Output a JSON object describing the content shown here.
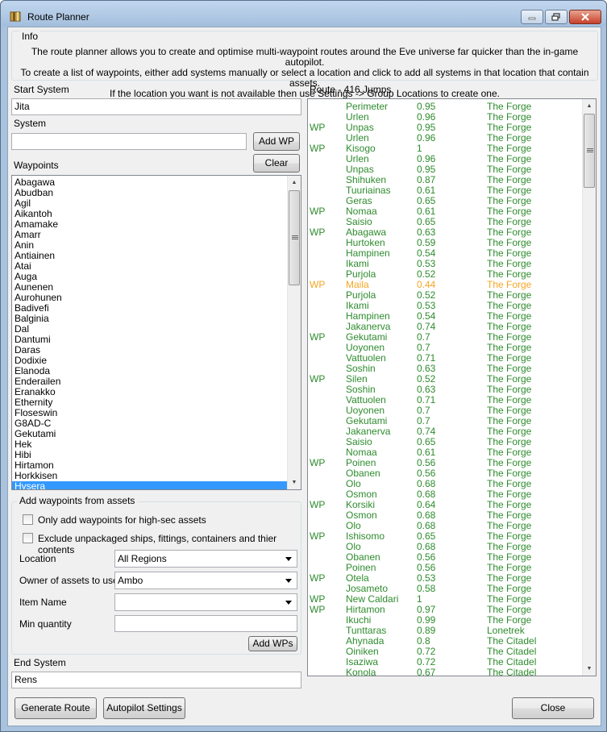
{
  "window": {
    "title": "Route Planner"
  },
  "info": {
    "legend": "Info",
    "line1": "The route planner allows you to create and optimise multi-waypoint routes around the Eve universe far quicker than the in-game autopilot.",
    "line2": "To create a list of waypoints, either add systems manually or select a location and click to add all systems in that location that contain assets.",
    "line3": "If the location you want is not available then use Settings -> Group Locations to create one."
  },
  "start_system": {
    "label": "Start System",
    "value": "Jita"
  },
  "system": {
    "label": "System",
    "value": ""
  },
  "buttons": {
    "add_wp": "Add WP",
    "clear": "Clear",
    "add_wps": "Add WPs",
    "generate_route": "Generate Route",
    "autopilot_settings": "Autopilot Settings",
    "close": "Close"
  },
  "waypoints": {
    "label": "Waypoints",
    "items": [
      "Abagawa",
      "Abudban",
      "Agil",
      "Aikantoh",
      "Amamake",
      "Amarr",
      "Anin",
      "Antiainen",
      "Atai",
      "Auga",
      "Aunenen",
      "Aurohunen",
      "Badivefi",
      "Balginia",
      "Dal",
      "Dantumi",
      "Daras",
      "Dodixie",
      "Elanoda",
      "Enderailen",
      "Eranakko",
      "Ethernity",
      "Floseswin",
      "G8AD-C",
      "Gekutami",
      "Hek",
      "Hibi",
      "Hirtamon",
      "Horkkisen",
      "Hysera"
    ],
    "selected": "Hysera"
  },
  "assets_group": {
    "legend": "Add waypoints from assets",
    "only_highsec": "Only add waypoints for high-sec assets",
    "exclude_unpackaged": "Exclude unpackaged ships, fittings, containers and thier contents",
    "location_label": "Location",
    "location_value": "All Regions",
    "owner_label": "Owner of assets to use",
    "owner_value": "Ambo",
    "item_name_label": "Item Name",
    "item_name_value": "",
    "min_qty_label": "Min quantity",
    "min_qty_value": ""
  },
  "end_system": {
    "label": "End System",
    "value": "Rens"
  },
  "route": {
    "label": "Route - 416 Jumps",
    "scroll_fraction": 0.0,
    "rows": [
      {
        "wp": "",
        "system": "Perimeter",
        "security": "0.95",
        "region": "The Forge",
        "highlight": false
      },
      {
        "wp": "",
        "system": "Urlen",
        "security": "0.96",
        "region": "The Forge",
        "highlight": false
      },
      {
        "wp": "WP",
        "system": "Unpas",
        "security": "0.95",
        "region": "The Forge",
        "highlight": false
      },
      {
        "wp": "",
        "system": "Urlen",
        "security": "0.96",
        "region": "The Forge",
        "highlight": false
      },
      {
        "wp": "WP",
        "system": "Kisogo",
        "security": "1",
        "region": "The Forge",
        "highlight": false
      },
      {
        "wp": "",
        "system": "Urlen",
        "security": "0.96",
        "region": "The Forge",
        "highlight": false
      },
      {
        "wp": "",
        "system": "Unpas",
        "security": "0.95",
        "region": "The Forge",
        "highlight": false
      },
      {
        "wp": "",
        "system": "Shihuken",
        "security": "0.87",
        "region": "The Forge",
        "highlight": false
      },
      {
        "wp": "",
        "system": "Tuuriainas",
        "security": "0.61",
        "region": "The Forge",
        "highlight": false
      },
      {
        "wp": "",
        "system": "Geras",
        "security": "0.65",
        "region": "The Forge",
        "highlight": false
      },
      {
        "wp": "WP",
        "system": "Nomaa",
        "security": "0.61",
        "region": "The Forge",
        "highlight": false
      },
      {
        "wp": "",
        "system": "Saisio",
        "security": "0.65",
        "region": "The Forge",
        "highlight": false
      },
      {
        "wp": "WP",
        "system": "Abagawa",
        "security": "0.63",
        "region": "The Forge",
        "highlight": false
      },
      {
        "wp": "",
        "system": "Hurtoken",
        "security": "0.59",
        "region": "The Forge",
        "highlight": false
      },
      {
        "wp": "",
        "system": "Hampinen",
        "security": "0.54",
        "region": "The Forge",
        "highlight": false
      },
      {
        "wp": "",
        "system": "Ikami",
        "security": "0.53",
        "region": "The Forge",
        "highlight": false
      },
      {
        "wp": "",
        "system": "Purjola",
        "security": "0.52",
        "region": "The Forge",
        "highlight": false
      },
      {
        "wp": "WP",
        "system": "Maila",
        "security": "0.44",
        "region": "The Forge",
        "highlight": true
      },
      {
        "wp": "",
        "system": "Purjola",
        "security": "0.52",
        "region": "The Forge",
        "highlight": false
      },
      {
        "wp": "",
        "system": "Ikami",
        "security": "0.53",
        "region": "The Forge",
        "highlight": false
      },
      {
        "wp": "",
        "system": "Hampinen",
        "security": "0.54",
        "region": "The Forge",
        "highlight": false
      },
      {
        "wp": "",
        "system": "Jakanerva",
        "security": "0.74",
        "region": "The Forge",
        "highlight": false
      },
      {
        "wp": "WP",
        "system": "Gekutami",
        "security": "0.7",
        "region": "The Forge",
        "highlight": false
      },
      {
        "wp": "",
        "system": "Uoyonen",
        "security": "0.7",
        "region": "The Forge",
        "highlight": false
      },
      {
        "wp": "",
        "system": "Vattuolen",
        "security": "0.71",
        "region": "The Forge",
        "highlight": false
      },
      {
        "wp": "",
        "system": "Soshin",
        "security": "0.63",
        "region": "The Forge",
        "highlight": false
      },
      {
        "wp": "WP",
        "system": "Silen",
        "security": "0.52",
        "region": "The Forge",
        "highlight": false
      },
      {
        "wp": "",
        "system": "Soshin",
        "security": "0.63",
        "region": "The Forge",
        "highlight": false
      },
      {
        "wp": "",
        "system": "Vattuolen",
        "security": "0.71",
        "region": "The Forge",
        "highlight": false
      },
      {
        "wp": "",
        "system": "Uoyonen",
        "security": "0.7",
        "region": "The Forge",
        "highlight": false
      },
      {
        "wp": "",
        "system": "Gekutami",
        "security": "0.7",
        "region": "The Forge",
        "highlight": false
      },
      {
        "wp": "",
        "system": "Jakanerva",
        "security": "0.74",
        "region": "The Forge",
        "highlight": false
      },
      {
        "wp": "",
        "system": "Saisio",
        "security": "0.65",
        "region": "The Forge",
        "highlight": false
      },
      {
        "wp": "",
        "system": "Nomaa",
        "security": "0.61",
        "region": "The Forge",
        "highlight": false
      },
      {
        "wp": "WP",
        "system": "Poinen",
        "security": "0.56",
        "region": "The Forge",
        "highlight": false
      },
      {
        "wp": "",
        "system": "Obanen",
        "security": "0.56",
        "region": "The Forge",
        "highlight": false
      },
      {
        "wp": "",
        "system": "Olo",
        "security": "0.68",
        "region": "The Forge",
        "highlight": false
      },
      {
        "wp": "",
        "system": "Osmon",
        "security": "0.68",
        "region": "The Forge",
        "highlight": false
      },
      {
        "wp": "WP",
        "system": "Korsiki",
        "security": "0.64",
        "region": "The Forge",
        "highlight": false
      },
      {
        "wp": "",
        "system": "Osmon",
        "security": "0.68",
        "region": "The Forge",
        "highlight": false
      },
      {
        "wp": "",
        "system": "Olo",
        "security": "0.68",
        "region": "The Forge",
        "highlight": false
      },
      {
        "wp": "WP",
        "system": "Ishisomo",
        "security": "0.65",
        "region": "The Forge",
        "highlight": false
      },
      {
        "wp": "",
        "system": "Olo",
        "security": "0.68",
        "region": "The Forge",
        "highlight": false
      },
      {
        "wp": "",
        "system": "Obanen",
        "security": "0.56",
        "region": "The Forge",
        "highlight": false
      },
      {
        "wp": "",
        "system": "Poinen",
        "security": "0.56",
        "region": "The Forge",
        "highlight": false
      },
      {
        "wp": "WP",
        "system": "Otela",
        "security": "0.53",
        "region": "The Forge",
        "highlight": false
      },
      {
        "wp": "",
        "system": "Josameto",
        "security": "0.58",
        "region": "The Forge",
        "highlight": false
      },
      {
        "wp": "WP",
        "system": "New Caldari",
        "security": "1",
        "region": "The Forge",
        "highlight": false
      },
      {
        "wp": "WP",
        "system": "Hirtamon",
        "security": "0.97",
        "region": "The Forge",
        "highlight": false
      },
      {
        "wp": "",
        "system": "Ikuchi",
        "security": "0.99",
        "region": "The Forge",
        "highlight": false
      },
      {
        "wp": "",
        "system": "Tunttaras",
        "security": "0.89",
        "region": "Lonetrek",
        "highlight": false
      },
      {
        "wp": "",
        "system": "Ahynada",
        "security": "0.8",
        "region": "The Citadel",
        "highlight": false
      },
      {
        "wp": "",
        "system": "Oiniken",
        "security": "0.72",
        "region": "The Citadel",
        "highlight": false
      },
      {
        "wp": "",
        "system": "Isaziwa",
        "security": "0.72",
        "region": "The Citadel",
        "highlight": false
      },
      {
        "wp": "",
        "system": "Konola",
        "security": "0.67",
        "region": "The Citadel",
        "highlight": false
      }
    ]
  },
  "colors": {
    "route_text": "#2e8b2e",
    "route_highlight": "#f5a623",
    "selection": "#3399ff"
  },
  "icons": {
    "app": "map-icon",
    "minimize": "minimize-icon",
    "maximize": "maximize-icon",
    "close": "close-icon"
  }
}
